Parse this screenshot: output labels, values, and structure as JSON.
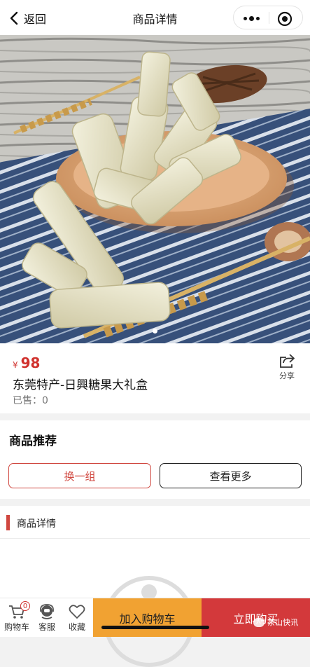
{
  "nav": {
    "back_label": "返回",
    "title": "商品详情"
  },
  "product": {
    "currency_symbol": "¥",
    "price": "98",
    "name": "东莞特产-日興糖果大礼盒",
    "sold": "已售：0",
    "share_label": "分享",
    "carousel": {
      "total": 1,
      "active": 1
    }
  },
  "recommend": {
    "title": "商品推荐",
    "swap_label": "换一组",
    "more_label": "查看更多"
  },
  "details": {
    "title": "商品详情"
  },
  "bottom_bar": {
    "cart_label": "购物车",
    "cart_count": "0",
    "service_label": "客服",
    "favorite_label": "收藏",
    "add_to_cart_label": "加入购物车",
    "buy_now_label": "立即购买"
  },
  "watermark": "茶山快讯",
  "colors": {
    "accent_red": "#d0312d",
    "add_cart_orange": "#f1a232",
    "buy_red": "#d3393b"
  }
}
